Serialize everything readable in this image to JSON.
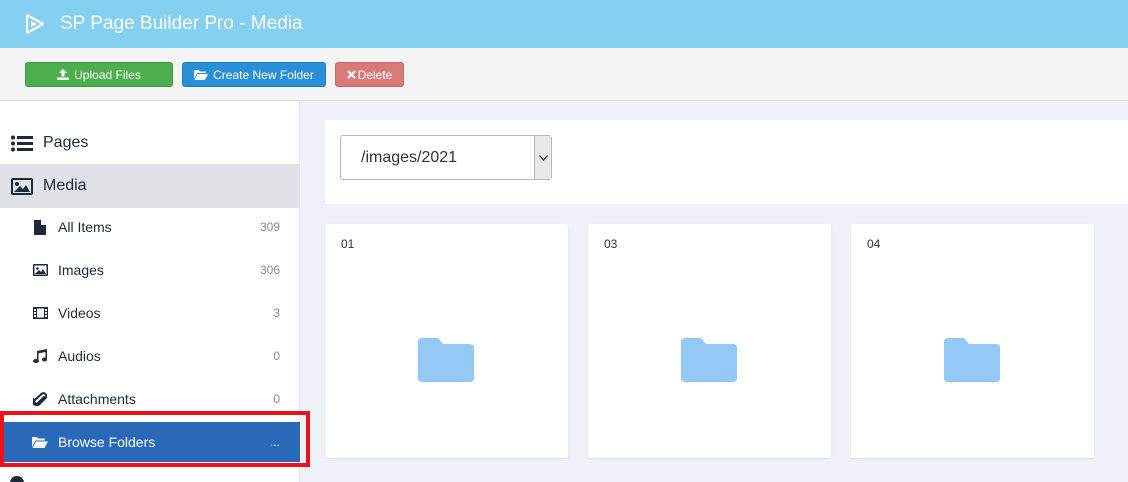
{
  "header": {
    "title": "SP Page Builder Pro - Media"
  },
  "toolbar": {
    "upload_label": "Upload Files",
    "new_folder_label": "Create New Folder",
    "delete_label": "Delete"
  },
  "sidebar": {
    "pages_label": "Pages",
    "media_label": "Media",
    "items": [
      {
        "label": "All Items",
        "count": "309",
        "icon": "file-icon"
      },
      {
        "label": "Images",
        "count": "306",
        "icon": "image-icon"
      },
      {
        "label": "Videos",
        "count": "3",
        "icon": "film-icon"
      },
      {
        "label": "Audios",
        "count": "0",
        "icon": "music-icon"
      },
      {
        "label": "Attachments",
        "count": "0",
        "icon": "paperclip-icon"
      },
      {
        "label": "Browse Folders",
        "count": "...",
        "icon": "folder-open-icon"
      }
    ]
  },
  "path": {
    "selected": "/images/2021"
  },
  "folders": [
    {
      "name": "01"
    },
    {
      "name": "03"
    },
    {
      "name": "04"
    }
  ],
  "colors": {
    "header": "#85cff0",
    "upload": "#4cae4c",
    "new_folder": "#2a8fd6",
    "delete": "#d97a7a",
    "active_item": "#2a68b8",
    "folder_icon": "#94c9f5",
    "highlight": "#e8141a"
  }
}
